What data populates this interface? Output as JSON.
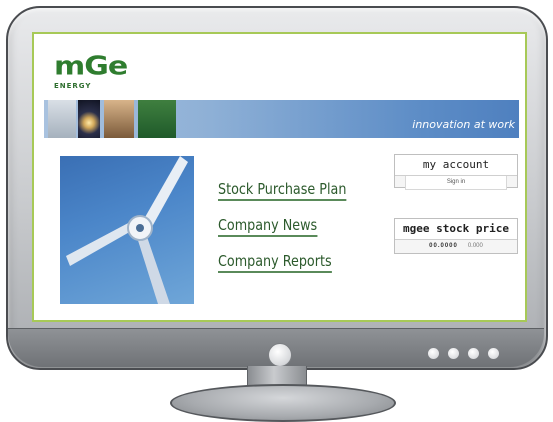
{
  "logo": {
    "main": "mGe",
    "sub": "ENERGY"
  },
  "banner": {
    "tagline": "innovation at work"
  },
  "links": [
    {
      "label": "Stock Purchase Plan"
    },
    {
      "label": "Company News"
    },
    {
      "label": "Company Reports"
    }
  ],
  "account": {
    "title": "my account",
    "sign_in": "Sign in"
  },
  "stock": {
    "title": "mgee stock price",
    "price": "00.0000",
    "change": "0.000"
  },
  "colors": {
    "screen_border": "#a7c957",
    "brand_green": "#2f7d2f",
    "banner_blue": "#5c8cc6"
  }
}
